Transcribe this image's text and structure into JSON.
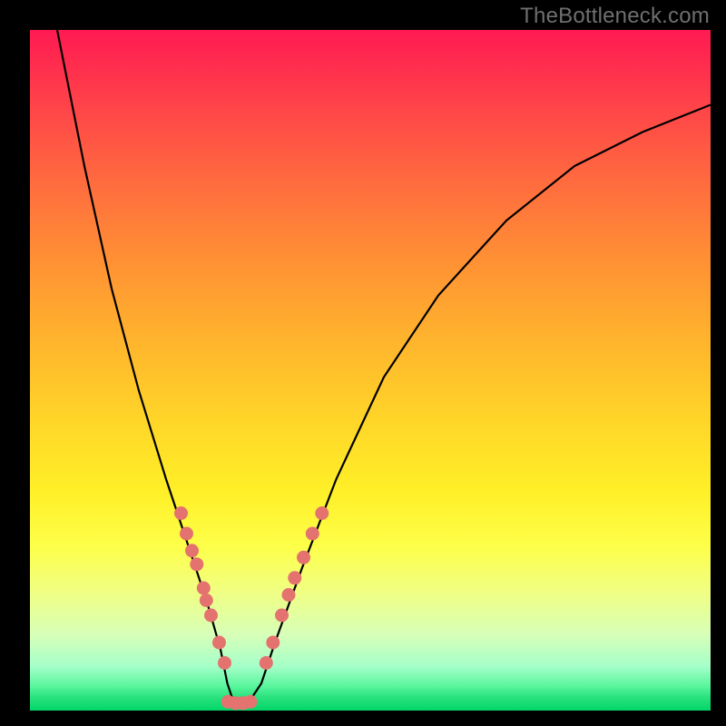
{
  "watermark": "TheBottleneck.com",
  "chart_data": {
    "type": "line",
    "title": "",
    "xlabel": "",
    "ylabel": "",
    "xlim": [
      0,
      100
    ],
    "ylim": [
      0,
      100
    ],
    "series": [
      {
        "name": "bottleneck-curve",
        "x": [
          4,
          8,
          12,
          16,
          20,
          24,
          26,
          28,
          29,
          30,
          31,
          32,
          34,
          36,
          40,
          45,
          52,
          60,
          70,
          80,
          90,
          100
        ],
        "y": [
          100,
          80,
          62,
          47,
          34,
          22,
          16,
          9,
          4,
          1,
          0.5,
          1,
          4,
          10,
          21,
          34,
          49,
          61,
          72,
          80,
          85,
          89
        ]
      }
    ],
    "markers": {
      "name": "highlight-dots",
      "color": "#e4736f",
      "points": [
        {
          "x": 22.2,
          "y": 29
        },
        {
          "x": 23.0,
          "y": 26
        },
        {
          "x": 23.8,
          "y": 23.5
        },
        {
          "x": 24.5,
          "y": 21.5
        },
        {
          "x": 25.5,
          "y": 18
        },
        {
          "x": 25.9,
          "y": 16.2
        },
        {
          "x": 26.6,
          "y": 14
        },
        {
          "x": 27.8,
          "y": 10
        },
        {
          "x": 28.6,
          "y": 7
        },
        {
          "x": 29.1,
          "y": 1.3
        },
        {
          "x": 30.2,
          "y": 1.1
        },
        {
          "x": 31.3,
          "y": 1.1
        },
        {
          "x": 32.4,
          "y": 1.3
        },
        {
          "x": 34.7,
          "y": 7
        },
        {
          "x": 35.7,
          "y": 10
        },
        {
          "x": 37.0,
          "y": 14
        },
        {
          "x": 38.0,
          "y": 17
        },
        {
          "x": 38.9,
          "y": 19.5
        },
        {
          "x": 40.2,
          "y": 22.5
        },
        {
          "x": 41.5,
          "y": 26
        },
        {
          "x": 42.9,
          "y": 29
        }
      ]
    }
  }
}
